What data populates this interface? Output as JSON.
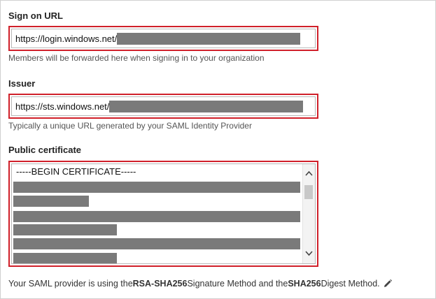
{
  "sign_on": {
    "label": "Sign on URL",
    "value_prefix": "https://login.windows.net/",
    "help": "Members will be forwarded here when signing in to your organization"
  },
  "issuer": {
    "label": "Issuer",
    "value_prefix": "https://sts.windows.net/",
    "help": "Typically a unique URL generated by your SAML Identity Provider"
  },
  "certificate": {
    "label": "Public certificate",
    "first_line": "-----BEGIN CERTIFICATE-----"
  },
  "footer": {
    "part1": "Your SAML provider is using the ",
    "sig_method": "RSA-SHA256",
    "part2": " Signature Method and the ",
    "digest_method": "SHA256",
    "part3": " Digest Method.",
    "edit_icon": "pencil-icon"
  },
  "colors": {
    "highlight": "#d0202a",
    "redaction": "#7a7a7a"
  }
}
